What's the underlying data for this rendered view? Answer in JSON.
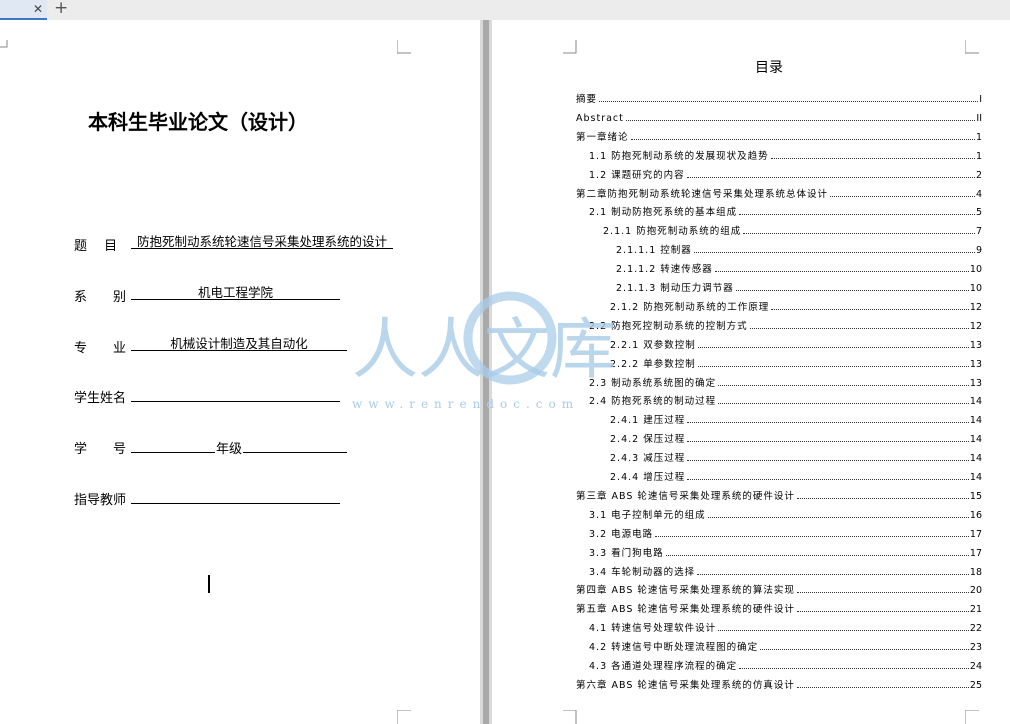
{
  "tabs": {
    "close_symbol": "✕",
    "add_symbol": "+"
  },
  "left_page": {
    "title": "本科生毕业论文（设计）",
    "fields": [
      {
        "label": "题　 目",
        "value": "防抱死制动系统轮速信号采集处理系统的设计"
      },
      {
        "label": "系　　别",
        "value": "机电工程学院"
      },
      {
        "label": "专　　业",
        "value": "机械设计制造及其自动化"
      },
      {
        "label": "学生姓名",
        "value": ""
      },
      {
        "label": "学　　号",
        "value": "",
        "suffix": "年级",
        "suffix_value": ""
      },
      {
        "label": "指导教师",
        "value": ""
      }
    ]
  },
  "right_page": {
    "heading": "目录",
    "toc": [
      {
        "text": "摘要",
        "page": "I",
        "level": 0
      },
      {
        "text": "Abstract",
        "page": "II",
        "level": 0
      },
      {
        "text": "第一章绪论",
        "page": "1",
        "level": 0
      },
      {
        "text": "1.1 防抱死制动系统的发展现状及趋势",
        "page": "1",
        "level": 1
      },
      {
        "text": "1.2 课题研究的内容",
        "page": "2",
        "level": 1
      },
      {
        "text": "第二章防抱死制动系统轮速信号采集处理系统总体设计",
        "page": "4",
        "level": 0
      },
      {
        "text": "2.1 制动防抱死系统的基本组成",
        "page": "5",
        "level": 1
      },
      {
        "text": "2.1.1 防抱死制动系统的组成",
        "page": "7",
        "level": 2
      },
      {
        "text": "2.1.1.1 控制器",
        "page": "9",
        "level": 3
      },
      {
        "text": "2.1.1.2 转速传感器",
        "page": "10",
        "level": 3
      },
      {
        "text": "2.1.1.3 制动压力调节器",
        "page": "10",
        "level": 3
      },
      {
        "text": "2.1.2 防抱死制动系统的工作原理",
        "page": "12",
        "level": 2.5
      },
      {
        "text": "2.2 防抱死控制动系统的控制方式",
        "page": "12",
        "level": 1
      },
      {
        "text": "2.2.1 双参数控制",
        "page": "13",
        "level": 2.5
      },
      {
        "text": "2.2.2 单参数控制",
        "page": "13",
        "level": 2.5
      },
      {
        "text": "2.3 制动系统系统图的确定",
        "page": "13",
        "level": 1
      },
      {
        "text": "2.4 防抱死系统的制动过程",
        "page": "14",
        "level": 1
      },
      {
        "text": "2.4.1 建压过程",
        "page": "14",
        "level": 2.5
      },
      {
        "text": "2.4.2 保压过程",
        "page": "14",
        "level": 2.5
      },
      {
        "text": "2.4.3 减压过程",
        "page": "14",
        "level": 2.5
      },
      {
        "text": "2.4.4 增压过程",
        "page": "14",
        "level": 2.5
      },
      {
        "text": "第三章 ABS 轮速信号采集处理系统的硬件设计",
        "page": "15",
        "level": 0
      },
      {
        "text": "3.1 电子控制单元的组成",
        "page": "16",
        "level": 1
      },
      {
        "text": "3.2 电源电路",
        "page": "17",
        "level": 1
      },
      {
        "text": "3.3 看门狗电路",
        "page": "17",
        "level": 1
      },
      {
        "text": "3.4 车轮制动器的选择",
        "page": "18",
        "level": 1
      },
      {
        "text": "第四章 ABS 轮速信号采集处理系统的算法实现",
        "page": "20",
        "level": 0
      },
      {
        "text": "第五章 ABS 轮速信号采集处理系统的硬件设计",
        "page": "21",
        "level": 0
      },
      {
        "text": "4.1 转速信号处理软件设计",
        "page": "22",
        "level": 1
      },
      {
        "text": "4.2 转速信号中断处理流程图的确定",
        "page": "23",
        "level": 1
      },
      {
        "text": "4.3 各通道处理程序流程的确定",
        "page": "24",
        "level": 1
      },
      {
        "text": "第六章 ABS 轮速信号采集处理系统的仿真设计",
        "page": "25",
        "level": 0
      }
    ]
  },
  "watermark": {
    "text": "人人文库",
    "url": "www.renrendoc.com",
    "color": "#a9cde8"
  }
}
